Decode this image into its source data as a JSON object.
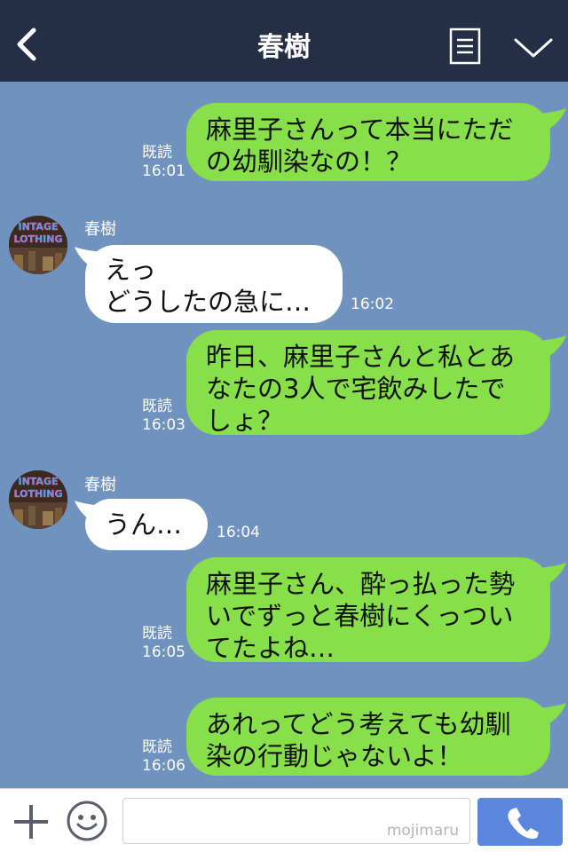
{
  "header": {
    "title": "春樹",
    "back_icon": "chevron-left-icon",
    "menu_icon": "list-icon",
    "more_icon": "chevron-down-icon"
  },
  "messages": [
    {
      "side": "out",
      "text": "麻里子さんって本当にただ\nの幼馴染なの！？",
      "read": "既読",
      "time": "16:01"
    },
    {
      "side": "in",
      "sender": "春樹",
      "text": "えっ\nどうしたの急に…",
      "time": "16:02"
    },
    {
      "side": "out",
      "text": "昨日、麻里子さんと私とあ\nなたの3人で宅飲みしたで\nしょ？",
      "read": "既読",
      "time": "16:03"
    },
    {
      "side": "in",
      "sender": "春樹",
      "text": "うん…",
      "time": "16:04"
    },
    {
      "side": "out",
      "text": "麻里子さん、酔っ払った勢\nいでずっと春樹にくっつい\nてたよね…",
      "read": "既読",
      "time": "16:05"
    },
    {
      "side": "out",
      "text": "あれってどう考えても幼馴\n染の行動じゃないよ！",
      "read": "既読",
      "time": "16:06"
    }
  ],
  "avatar": {
    "text_line1": "INTAGE",
    "text_line2": "LOTHING"
  },
  "footer": {
    "watermark": "mojimaru",
    "input_value": "",
    "call_icon": "phone-icon",
    "add_icon": "plus-icon",
    "emoji_icon": "smiley-icon"
  },
  "colors": {
    "header_bg": "#242e45",
    "chat_bg": "#7092bf",
    "outgoing_bubble": "#87e04a",
    "incoming_bubble": "#ffffff",
    "call_button": "#5a87dc"
  }
}
